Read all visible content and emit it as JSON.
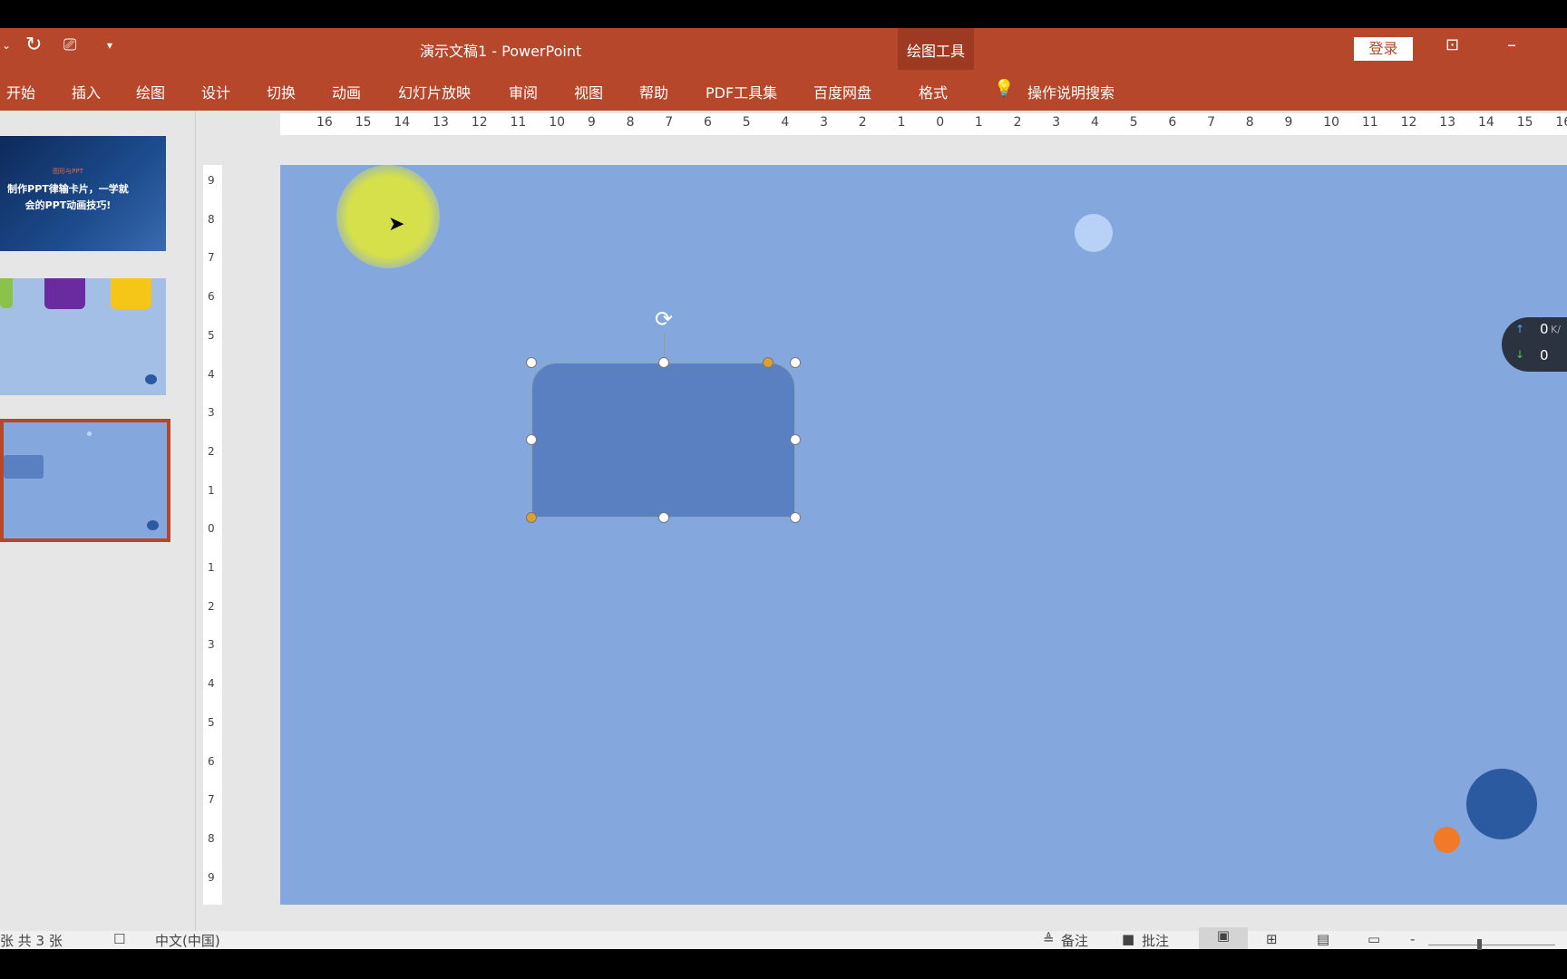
{
  "titlebar": {
    "title": "演示文稿1  -  PowerPoint",
    "context_group": "绘图工具",
    "login": "登录"
  },
  "ribbon": {
    "tabs": [
      "开始",
      "插入",
      "绘图",
      "设计",
      "切换",
      "动画",
      "幻灯片放映",
      "审阅",
      "视图",
      "帮助",
      "PDF工具集",
      "百度网盘",
      "格式"
    ],
    "active_tab": "格式",
    "search": "操作说明搜索"
  },
  "ruler": {
    "h_labels": [
      "16",
      "15",
      "14",
      "13",
      "12",
      "11",
      "10",
      "9",
      "8",
      "7",
      "6",
      "5",
      "4",
      "3",
      "2",
      "1",
      "0",
      "1",
      "2",
      "3",
      "4",
      "5",
      "6",
      "7",
      "8",
      "9",
      "10",
      "11",
      "12",
      "13",
      "14",
      "15",
      "16"
    ],
    "v_labels": [
      "9",
      "8",
      "7",
      "6",
      "5",
      "4",
      "3",
      "2",
      "1",
      "0",
      "1",
      "2",
      "3",
      "4",
      "5",
      "6",
      "7",
      "8",
      "9"
    ]
  },
  "thumbnails": {
    "slide1": {
      "tag": "图形与PPT",
      "title_line1": "制作PPT律输卡片，一学就",
      "title_line2": "会的PPT动画技巧!"
    },
    "selected": 3
  },
  "network": {
    "up": "0",
    "down": "0",
    "unit": "K/"
  },
  "status": {
    "slide_of": "张 共 3 张",
    "language": "中文(中国)",
    "notes": "备注",
    "comments": "批注"
  },
  "colors": {
    "accent": "#b7472a",
    "slide_bg": "#84a8de",
    "shape": "#5b80c2"
  }
}
